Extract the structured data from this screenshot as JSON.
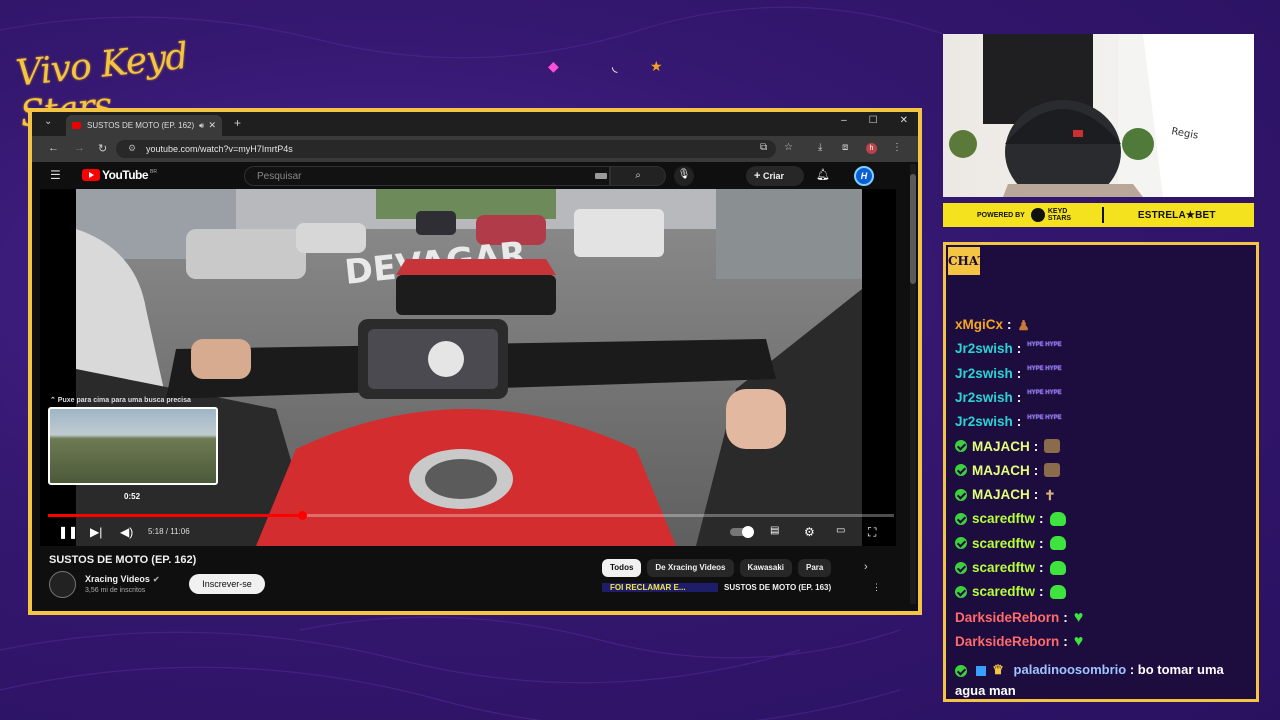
{
  "overlay": {
    "brand_text": "Vivo Keyd Stars",
    "accent_color": "#f4c542",
    "chat_label": "CHAT",
    "sponsor": {
      "powered_by": "POWERED BY",
      "keyd_stars": "KEYD STARS",
      "estrela_bet": "ESTRELA★BET"
    }
  },
  "browser": {
    "tab_title": "SUSTOS DE MOTO (EP. 162)",
    "url": "youtube.com/watch?v=myH7ImrtP4s",
    "icons": [
      "chevron-down-icon",
      "close-icon",
      "plus-icon",
      "minimize-icon",
      "maximize-icon",
      "back-icon",
      "forward-icon",
      "reload-icon",
      "site-info-icon",
      "install-icon",
      "star-icon",
      "download-icon",
      "extensions-icon",
      "menu-icon"
    ]
  },
  "youtube": {
    "logo_text": "YouTube",
    "logo_region": "BR",
    "search_placeholder": "Pesquisar",
    "create_label": "Criar",
    "avatar_letter": "H",
    "player": {
      "hint": "⌃ Puxe para cima para uma busca precisa",
      "preview_time": "0:52",
      "timecode": "5:18 / 11:06",
      "progress": 0.3
    },
    "video_title": "SUSTOS DE MOTO (EP. 162)",
    "channel_name": "Xracing Videos",
    "channel_subs": "3,56 mi de inscritos",
    "subscribe_label": "Inscrever-se",
    "chips": [
      "Todos",
      "De Xracing Videos",
      "Kawasaki",
      "Para"
    ],
    "rec_thumb_text": "FOI RECLAMAR E...",
    "rec_title": "SUSTOS DE MOTO (EP. 163)"
  },
  "chat": {
    "messages": [
      {
        "user": "xMgiCx",
        "color": "#f5a623",
        "badge": false,
        "emote": "glyph"
      },
      {
        "user": "Jr2swish",
        "color": "#2ad4d4",
        "badge": false,
        "emote": "hype"
      },
      {
        "user": "Jr2swish",
        "color": "#2ad4d4",
        "badge": false,
        "emote": "hype"
      },
      {
        "user": "Jr2swish",
        "color": "#2ad4d4",
        "badge": false,
        "emote": "hype"
      },
      {
        "user": "Jr2swish",
        "color": "#2ad4d4",
        "badge": false,
        "emote": "hype"
      },
      {
        "user": "MAJACH",
        "color": "#e6ff7a",
        "badge": true,
        "emote": "box"
      },
      {
        "user": "MAJACH",
        "color": "#e6ff7a",
        "badge": true,
        "emote": "box"
      },
      {
        "user": "MAJACH",
        "color": "#e6ff7a",
        "badge": true,
        "emote": "stick"
      },
      {
        "user": "scaredftw",
        "color": "#b6ff3a",
        "badge": true,
        "emote": "frog"
      },
      {
        "user": "scaredftw",
        "color": "#b6ff3a",
        "badge": true,
        "emote": "frog"
      },
      {
        "user": "scaredftw",
        "color": "#b6ff3a",
        "badge": true,
        "emote": "frog"
      },
      {
        "user": "scaredftw",
        "color": "#b6ff3a",
        "badge": true,
        "emote": "frog"
      },
      {
        "user": "DarksideReborn",
        "color": "#ff6a6a",
        "badge": false,
        "emote": "heart"
      },
      {
        "user": "DarksideReborn",
        "color": "#ff6a6a",
        "badge": false,
        "emote": "heart"
      }
    ],
    "last_message": {
      "user": "paladinoosombrio",
      "user_color": "#9fc4ff",
      "text": "bo tomar uma agua man"
    },
    "hype_text": "HYPE HYPE"
  }
}
